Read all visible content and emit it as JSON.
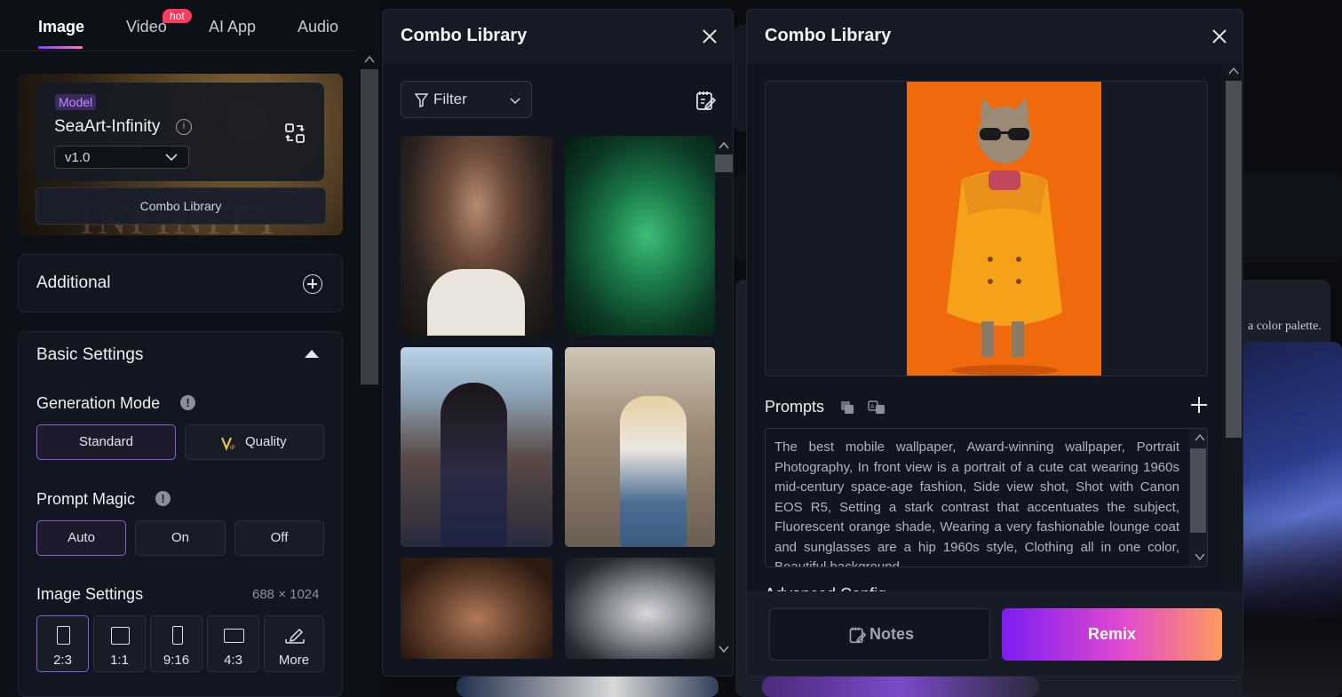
{
  "top_tabs": [
    {
      "label": "Image"
    },
    {
      "label": "Video",
      "badge": "hot"
    },
    {
      "label": "AI App"
    },
    {
      "label": "Audio"
    }
  ],
  "model": {
    "tag": "Model",
    "name": "SeaArt-Infinity",
    "version": "v1.0",
    "background_text": "INFINITY",
    "combo_button": "Combo Library"
  },
  "additional": {
    "title": "Additional"
  },
  "basic_settings": {
    "title": "Basic Settings",
    "generation_mode": {
      "label": "Generation Mode",
      "options": [
        "Standard",
        "Quality"
      ],
      "selected": "Standard"
    },
    "prompt_magic": {
      "label": "Prompt Magic",
      "options": [
        "Auto",
        "On",
        "Off"
      ],
      "selected": "Auto"
    },
    "image_settings": {
      "label": "Image Settings",
      "size": "688 × 1024",
      "ratios": [
        "2:3",
        "1:1",
        "9:16",
        "4:3",
        "More"
      ],
      "selected": "2:3"
    }
  },
  "combo_library_left": {
    "title": "Combo Library",
    "filter_label": "Filter",
    "thumbnails": [
      "portrait-woman-white-top",
      "green-code-face",
      "smiling-woman-street",
      "blonde-woman-kitchen",
      "man-portrait-bokeh",
      "armored-knight"
    ]
  },
  "combo_library_right": {
    "title": "Combo Library",
    "prompts_label": "Prompts",
    "prompt_text": "The best mobile wallpaper, Award-winning wallpaper, Portrait Photography, In front view is a portrait of a cute cat wearing 1960s mid-century space-age fashion, Side view shot, Shot with Canon EOS R5, Setting a stark contrast that accentuates the subject, Fluorescent orange shade, Wearing a very fashionable lounge coat and sunglasses are a hip 1960s style, Clothing all in one color, Beautiful background",
    "advanced_label": "Advanced Config",
    "notes_label": "Notes",
    "remix_label": "Remix"
  },
  "background": {
    "caption_fragment": "a color palette."
  },
  "colors": {
    "accent_purple": "#8a5cd6",
    "remix_start": "#7d1cf2",
    "remix_end": "#ff9a5c",
    "hot_badge": "#ff3b5c",
    "cat_bg": "#f06a0d"
  }
}
